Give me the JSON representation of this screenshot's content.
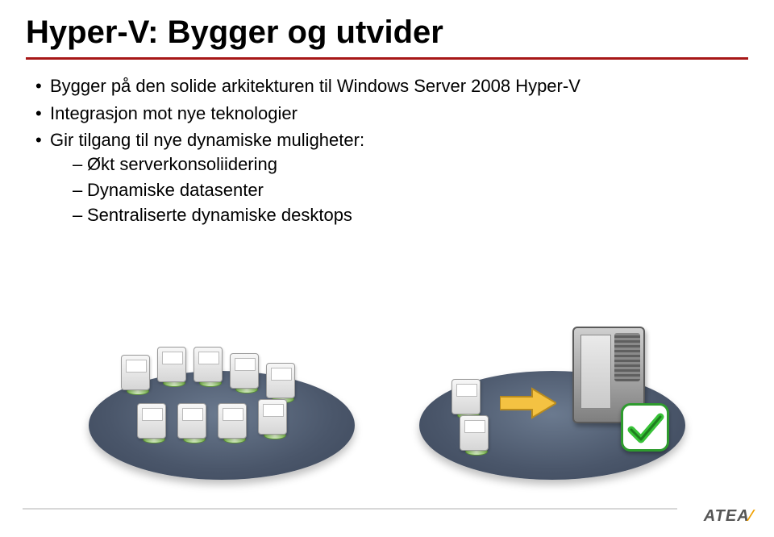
{
  "title": "Hyper-V: Bygger og utvider",
  "bullets": {
    "b1": "Bygger på den solide arkitekturen til Windows Server 2008 Hyper-V",
    "b2": "Integrasjon mot nye teknologier",
    "b3": "Gir tilgang til nye dynamiske muligheter:",
    "s1": "Økt serverkonsoliidering",
    "s2": "Dynamiske datasenter",
    "s3": "Sentraliserte dynamiske desktops"
  },
  "logo": {
    "name": "ATEA"
  }
}
